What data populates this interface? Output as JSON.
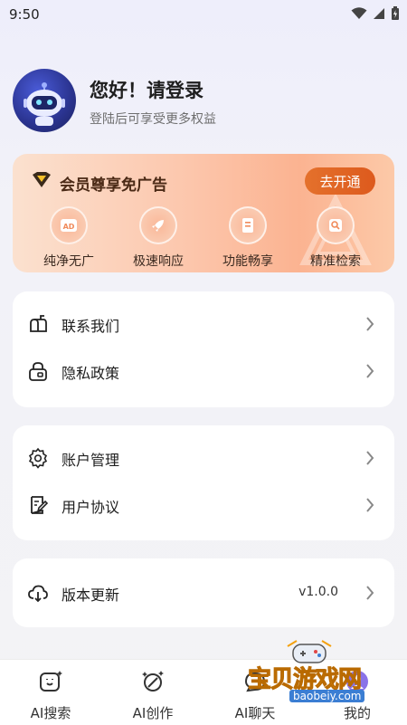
{
  "status_bar": {
    "time": "9:50"
  },
  "profile": {
    "greeting": "您好！请登录",
    "subtitle": "登陆后可享受更多权益"
  },
  "vip": {
    "title": "会员尊享免广告",
    "button": "去开通",
    "features": [
      {
        "label": "纯净无广",
        "icon": "ad-icon"
      },
      {
        "label": "极速响应",
        "icon": "rocket-icon"
      },
      {
        "label": "功能畅享",
        "icon": "document-icon"
      },
      {
        "label": "精准检索",
        "icon": "search-image-icon"
      }
    ]
  },
  "menu": {
    "group1": [
      {
        "label": "联系我们",
        "icon": "mailbox-icon"
      },
      {
        "label": "隐私政策",
        "icon": "lock-icon"
      }
    ],
    "group2": [
      {
        "label": "账户管理",
        "icon": "gear-icon"
      },
      {
        "label": "用户协议",
        "icon": "agreement-icon"
      }
    ],
    "group3": [
      {
        "label": "版本更新",
        "icon": "cloud-download-icon",
        "value": "v1.0.0"
      }
    ]
  },
  "bottom_nav": [
    {
      "label": "AI搜索",
      "icon": "ai-search-icon"
    },
    {
      "label": "AI创作",
      "icon": "ai-create-icon"
    },
    {
      "label": "AI聊天",
      "icon": "ai-chat-icon"
    },
    {
      "label": "我的",
      "icon": "profile-icon"
    }
  ],
  "watermark": {
    "text": "宝贝游戏网",
    "url": "baobeiy.com"
  },
  "colors": {
    "accent": "#e0621f",
    "vip_card": "#fcc7ad"
  }
}
